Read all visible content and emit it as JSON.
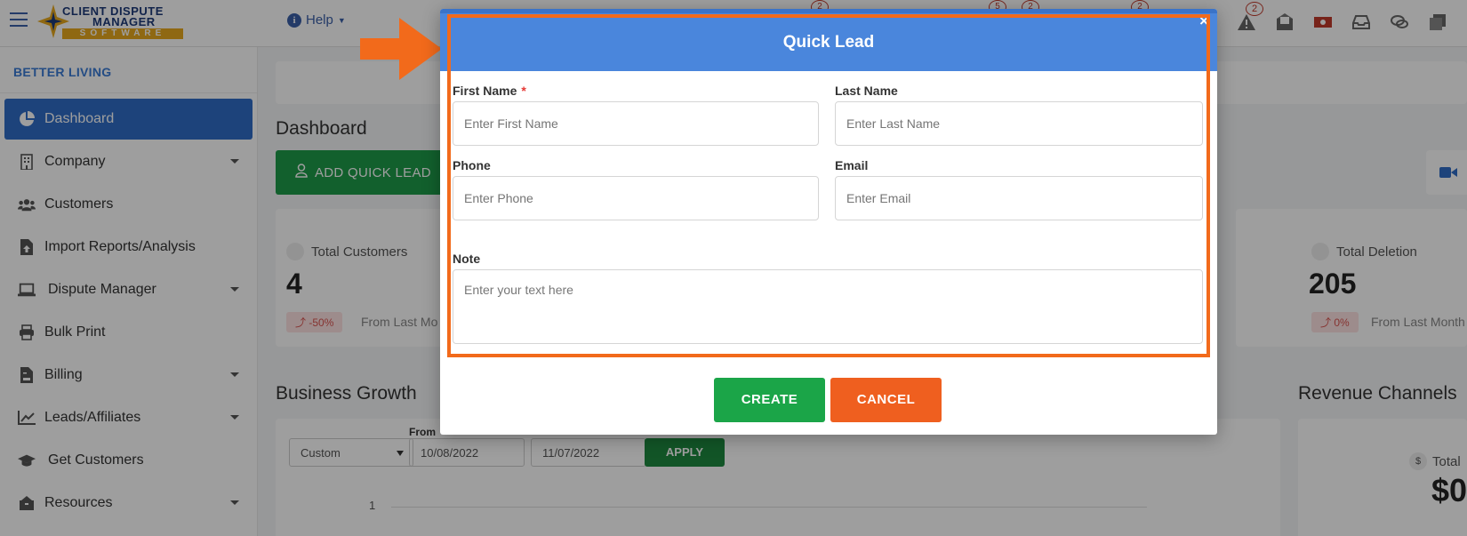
{
  "logo": {
    "line1": "CLIENT DISPUTE",
    "line2": "MANAGER",
    "line3": "SOFTWARE"
  },
  "header": {
    "help_label": "Help",
    "notifications_badge": "2",
    "background_badges": [
      "2",
      "5",
      "2",
      "2"
    ]
  },
  "sidebar": {
    "org_name": "BETTER LIVING",
    "items": [
      {
        "label": "Dashboard",
        "icon": "pie-chart-icon",
        "active": true,
        "has_submenu": false
      },
      {
        "label": "Company",
        "icon": "building-icon",
        "has_submenu": true
      },
      {
        "label": "Customers",
        "icon": "users-icon",
        "has_submenu": false
      },
      {
        "label": "Import Reports/Analysis",
        "icon": "file-upload-icon",
        "has_submenu": false
      },
      {
        "label": "Dispute Manager",
        "icon": "laptop-icon",
        "has_submenu": true
      },
      {
        "label": "Bulk Print",
        "icon": "printer-icon",
        "has_submenu": false
      },
      {
        "label": "Billing",
        "icon": "invoice-icon",
        "has_submenu": true
      },
      {
        "label": "Leads/Affiliates",
        "icon": "chart-line-icon",
        "has_submenu": true
      },
      {
        "label": "Get Customers",
        "icon": "graduation-cap-icon",
        "has_submenu": false
      },
      {
        "label": "Resources",
        "icon": "box-icon",
        "has_submenu": true
      }
    ]
  },
  "dashboard": {
    "title": "Dashboard",
    "add_quick_lead": "ADD QUICK LEAD",
    "cards": [
      {
        "label": "Total Customers",
        "value": "4",
        "change": "-50%",
        "from": "From Last Mo"
      },
      {
        "label": "Total Deletion",
        "value": "205",
        "change": "0%",
        "from": "From Last Month"
      }
    ],
    "business_growth_title": "Business Growth",
    "revenue_title": "Revenue Channels",
    "revenue_label": "Total",
    "revenue_value": "$0",
    "range_select": "Custom",
    "from_label": "From",
    "date_from": "10/08/2022",
    "date_to": "11/07/2022",
    "apply_label": "APPLY",
    "axis_tick": "1"
  },
  "modal": {
    "title": "Quick Lead",
    "close_glyph": "×",
    "fields": {
      "first_name": {
        "label": "First Name",
        "required_mark": "*",
        "placeholder": "Enter First Name"
      },
      "last_name": {
        "label": "Last Name",
        "placeholder": "Enter Last Name"
      },
      "phone": {
        "label": "Phone",
        "placeholder": "Enter Phone"
      },
      "email": {
        "label": "Email",
        "placeholder": "Enter Email"
      },
      "note": {
        "label": "Note",
        "placeholder": "Enter your text here"
      }
    },
    "create_label": "CREATE",
    "cancel_label": "CANCEL"
  },
  "colors": {
    "accent": "#4a86dc",
    "highlight": "#f26a1b",
    "create": "#1ba548",
    "cancel": "#ef5f1f"
  }
}
